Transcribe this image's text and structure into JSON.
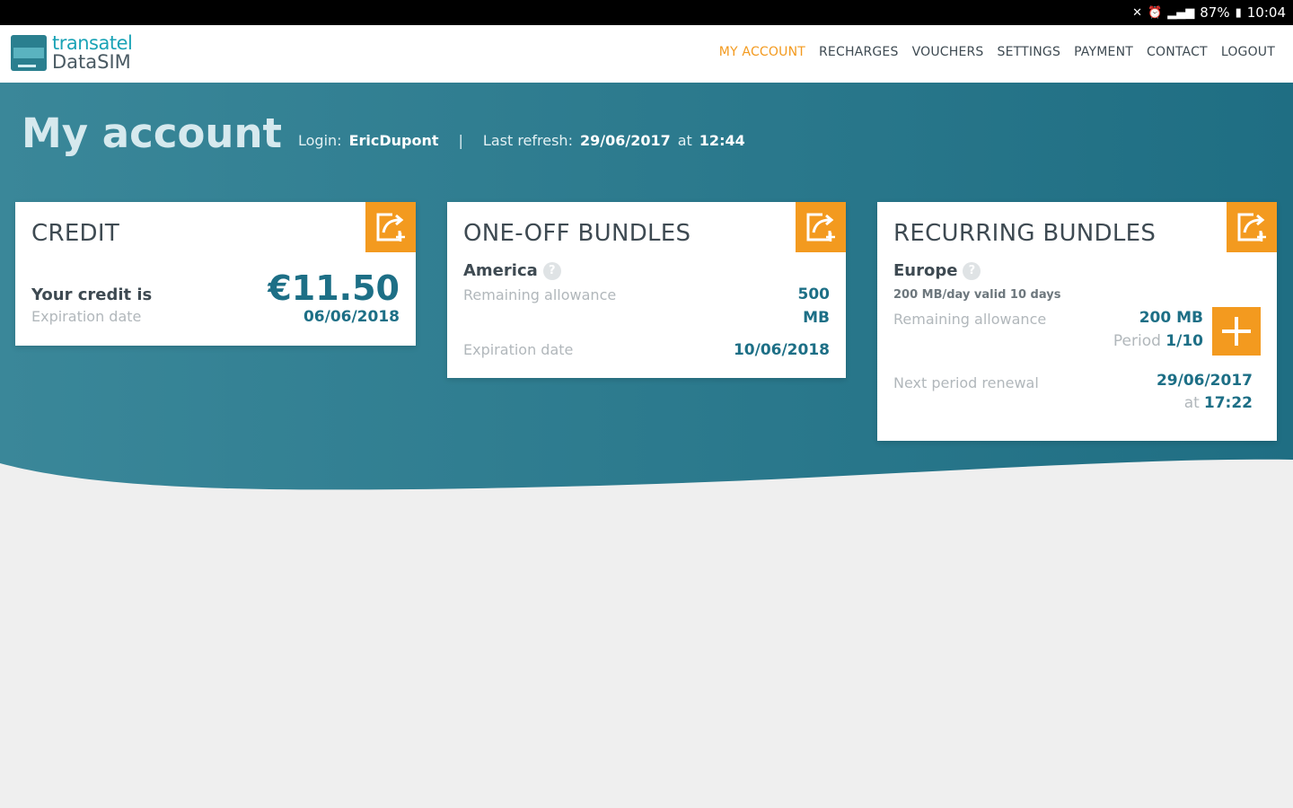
{
  "status_bar": {
    "battery": "87%",
    "time": "10:04"
  },
  "logo": {
    "brand": "transatel",
    "product": "DataSIM"
  },
  "nav": [
    {
      "label": "MY ACCOUNT",
      "active": true
    },
    {
      "label": "RECHARGES"
    },
    {
      "label": "VOUCHERS"
    },
    {
      "label": "SETTINGS"
    },
    {
      "label": "PAYMENT"
    },
    {
      "label": "CONTACT"
    },
    {
      "label": "LOGOUT"
    }
  ],
  "page": {
    "title": "My account",
    "login_label": "Login:",
    "login_value": "EricDupont",
    "separator": "|",
    "refresh_label": "Last refresh:",
    "refresh_date": "29/06/2017",
    "refresh_at": "at",
    "refresh_time": "12:44"
  },
  "credit": {
    "title": "CREDIT",
    "credit_label": "Your credit is",
    "credit_value": "€11.50",
    "expiration_label": "Expiration date",
    "expiration_value": "06/06/2018"
  },
  "one_off": {
    "title": "ONE-OFF BUNDLES",
    "bundle_name": "America",
    "remaining_label": "Remaining allowance",
    "remaining_value_num": "500",
    "remaining_value_unit": "MB",
    "expiration_label": "Expiration date",
    "expiration_value": "10/06/2018"
  },
  "recurring": {
    "title": "RECURRING BUNDLES",
    "bundle_name": "Europe",
    "bundle_desc": "200 MB/day valid 10 days",
    "remaining_label": "Remaining allowance",
    "remaining_value": "200 MB",
    "period_label": "Period",
    "period_value": "1/10",
    "renewal_label": "Next period renewal",
    "renewal_date": "29/06/2017",
    "renewal_at": "at",
    "renewal_time": "17:22"
  },
  "colors": {
    "accent": "#f39a1f",
    "teal": "#1d6f86",
    "hero": "#2a7488"
  }
}
